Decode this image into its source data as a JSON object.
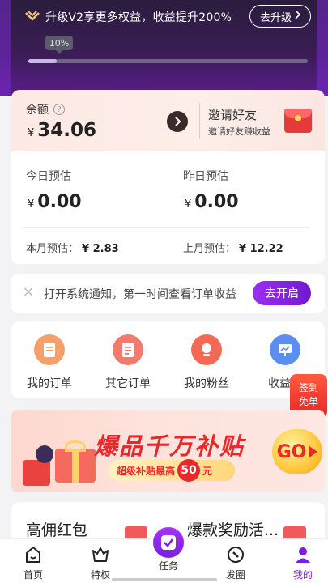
{
  "header": {
    "promo_text": "升级V2享更多权益，收益提升200%",
    "upgrade_button": "去升级",
    "progress_label": "10%",
    "progress_value": 0.1
  },
  "balance": {
    "label": "余额",
    "currency": "¥",
    "amount": "34.06",
    "invite_title": "邀请好友",
    "invite_subtitle": "邀请好友赚收益"
  },
  "estimates": {
    "today_label": "今日预估",
    "today_value": "0.00",
    "yesterday_label": "昨日预估",
    "yesterday_value": "0.00",
    "currency": "¥",
    "this_month_label": "本月预估：",
    "this_month_value": "¥ 2.83",
    "last_month_label": "上月预估：",
    "last_month_value": "¥ 12.22"
  },
  "notice": {
    "text": "打开系统通知，第一时间查看订单收益",
    "button": "去开启"
  },
  "shortcuts": {
    "items": [
      {
        "label": "我的订单",
        "icon": "order-icon",
        "color": "#f5a06a"
      },
      {
        "label": "其它订单",
        "icon": "other-order-icon",
        "color": "#f37b6d"
      },
      {
        "label": "我的粉丝",
        "icon": "fans-icon",
        "color": "#f26a55"
      },
      {
        "label": "收益报",
        "icon": "report-icon",
        "color": "#5a8ff0"
      }
    ],
    "signin_line1": "签到",
    "signin_line2": "免单"
  },
  "banner": {
    "title": "爆品千万补贴",
    "subtitle_prefix": "超级补贴最高",
    "subtitle_amount": "50",
    "subtitle_suffix": "元",
    "go_label": "GO"
  },
  "bottom_cards": {
    "left_title": "高佣红包",
    "right_title": "爆款奖励活..."
  },
  "tabbar": {
    "tabs": [
      {
        "label": "首页"
      },
      {
        "label": "特权"
      },
      {
        "label": "任务"
      },
      {
        "label": "发圈"
      },
      {
        "label": "我的"
      }
    ],
    "active_color": "#7a1fe0"
  }
}
